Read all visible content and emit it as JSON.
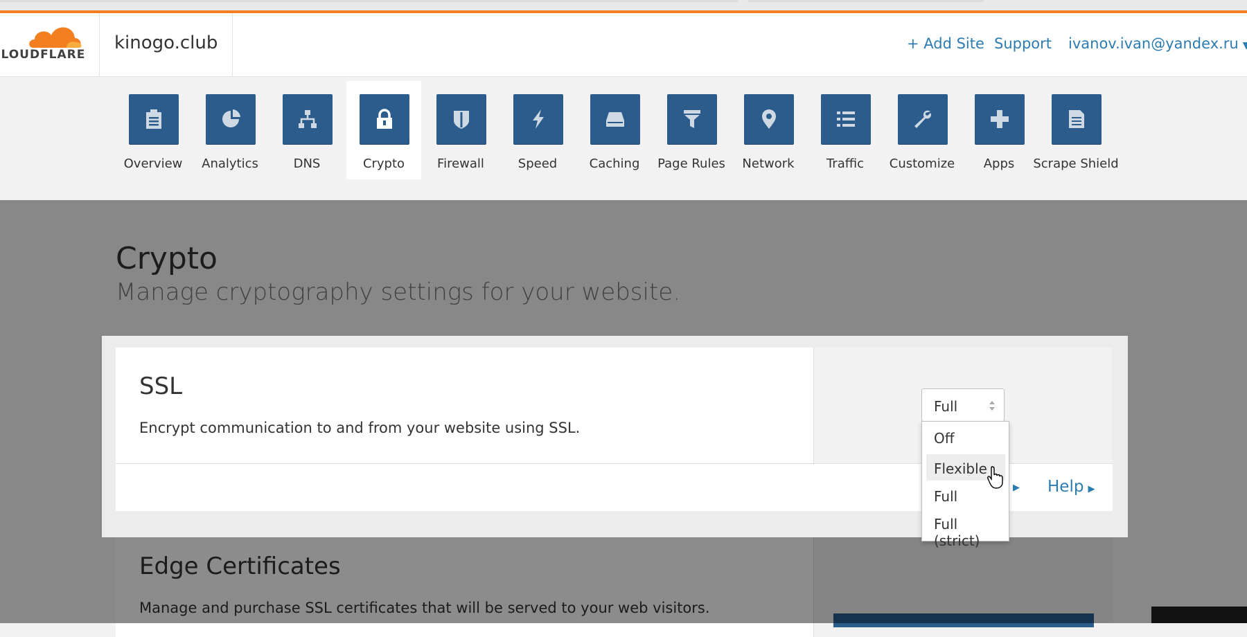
{
  "header": {
    "logo_text": "CLOUDFLARE",
    "site": "kinogo.club",
    "add_site": "+ Add Site",
    "support": "Support",
    "user": "ivanov.ivan@yandex.ru"
  },
  "nav": [
    {
      "label": "Overview",
      "icon": "clipboard-icon"
    },
    {
      "label": "Analytics",
      "icon": "pie-chart-icon"
    },
    {
      "label": "DNS",
      "icon": "network-tree-icon"
    },
    {
      "label": "Crypto",
      "icon": "lock-icon",
      "active": true
    },
    {
      "label": "Firewall",
      "icon": "shield-icon"
    },
    {
      "label": "Speed",
      "icon": "lightning-icon"
    },
    {
      "label": "Caching",
      "icon": "drive-icon"
    },
    {
      "label": "Page Rules",
      "icon": "filter-icon"
    },
    {
      "label": "Network",
      "icon": "location-pin-icon"
    },
    {
      "label": "Traffic",
      "icon": "list-icon"
    },
    {
      "label": "Customize",
      "icon": "wrench-icon"
    },
    {
      "label": "Apps",
      "icon": "plus-icon"
    },
    {
      "label": "Scrape Shield",
      "icon": "document-icon"
    }
  ],
  "page": {
    "title": "Crypto",
    "subtitle": "Manage cryptography settings for your website."
  },
  "ssl": {
    "title": "SSL",
    "description": "Encrypt communication to and from your website using SSL.",
    "selected": "Full",
    "options": [
      "Off",
      "Flexible",
      "Full",
      "Full (strict)"
    ],
    "hovered_option": "Flexible",
    "help": "Help"
  },
  "edge": {
    "title": "Edge Certificates",
    "description": "Manage and purchase SSL certificates that will be served to your web visitors."
  },
  "colors": {
    "brand_orange": "#f38020",
    "tile_blue": "#2b5c8c",
    "link_blue": "#2c7cb0"
  }
}
